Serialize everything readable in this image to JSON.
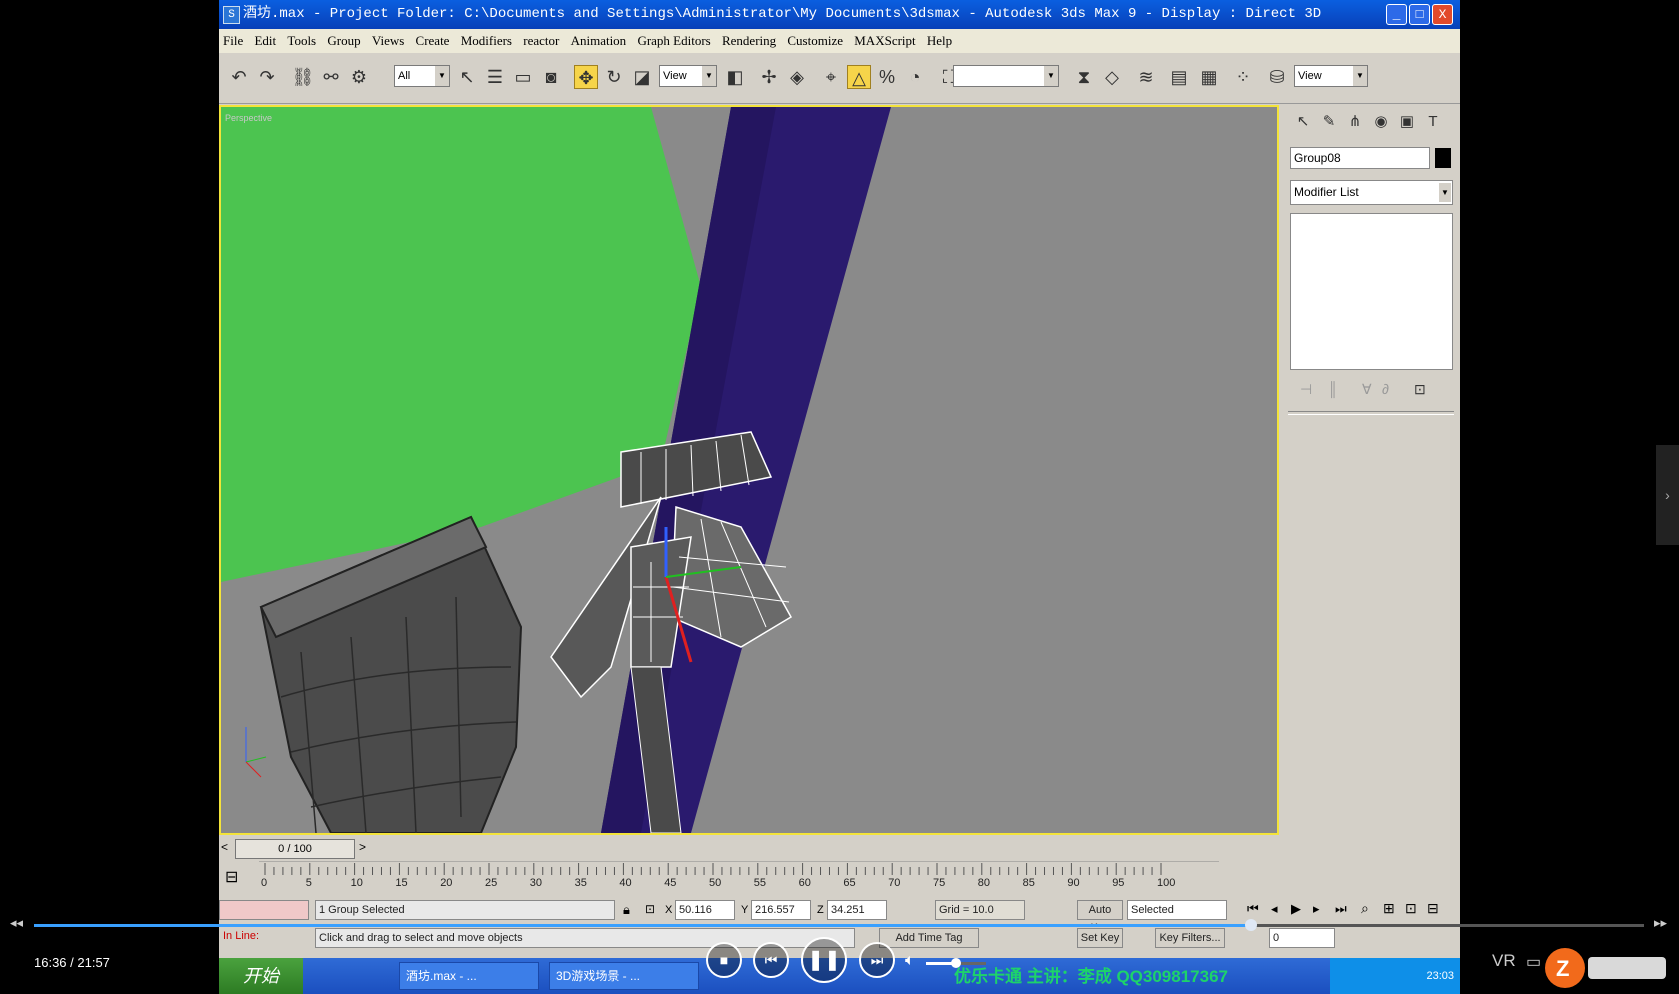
{
  "window": {
    "title": "酒坊.max     - Project Folder: C:\\Documents and Settings\\Administrator\\My Documents\\3dsmax     - Autodesk 3ds Max 9     - Display : Direct 3D",
    "min": "_",
    "max": "□",
    "close": "X"
  },
  "menu": [
    "File",
    "Edit",
    "Tools",
    "Group",
    "Views",
    "Create",
    "Modifiers",
    "reactor",
    "Animation",
    "Graph Editors",
    "Rendering",
    "Customize",
    "MAXScript",
    "Help"
  ],
  "toolbar": {
    "selection_filter": "All",
    "ref_coord": "View",
    "named_sel": "",
    "view_dropdown": "View"
  },
  "viewport": {
    "label": "Perspective",
    "colors": {
      "green": "#4cc450",
      "purple": "#2a1a6e",
      "gray": "#8a8a8a",
      "border": "#f3e33a"
    }
  },
  "command_panel": {
    "object_name": "Group08",
    "modifier_list": "Modifier List"
  },
  "timeline": {
    "frame": "0 / 100",
    "prev": "<",
    "next": ">",
    "ticks": [
      "0",
      "5",
      "10",
      "15",
      "20",
      "25",
      "30",
      "35",
      "40",
      "45",
      "50",
      "55",
      "60",
      "65",
      "70",
      "75",
      "80",
      "85",
      "90",
      "95",
      "100"
    ]
  },
  "status": {
    "selection": "1 Group Selected",
    "x_label": "X",
    "x": "50.116",
    "y_label": "Y",
    "y": "216.557",
    "z_label": "Z",
    "z": "34.251",
    "grid": "Grid = 10.0",
    "auto_key": "Auto Key",
    "key_mode": "Selected",
    "prompt": "Click and drag to select and move objects",
    "add_time_tag": "Add Time Tag",
    "set_key": "Set Key",
    "key_filters": "Key Filters...",
    "frame_field": "0",
    "maxscript": "In Line:"
  },
  "taskbar": {
    "start": "开始",
    "tasks": [
      "酒坊.max - ...",
      "3D游戏场景 - ..."
    ],
    "clock": "23:03",
    "watermark": "优乐卡通 主讲：李成 QQ309817367"
  },
  "player": {
    "time": "16:36 / 21:57",
    "progress": 0.756,
    "volume": 0.5,
    "vr": "VR",
    "rewind": "◂◂",
    "forward": "▸▸"
  }
}
